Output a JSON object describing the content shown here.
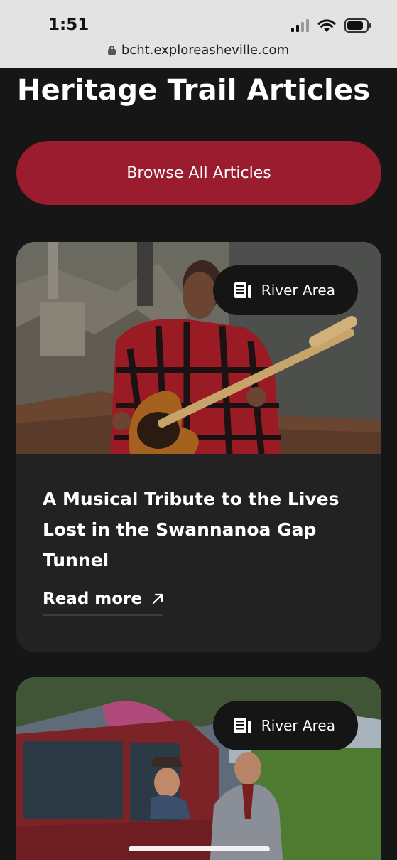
{
  "status_bar": {
    "time": "1:51"
  },
  "browser": {
    "url": "bcht.exploreasheville.com"
  },
  "page": {
    "title": "Heritage Trail Articles"
  },
  "actions": {
    "browse_label": "Browse All Articles"
  },
  "articles": [
    {
      "area": "River Area",
      "title": "A Musical Tribute to the Lives Lost in the Swannanoa Gap Tunnel",
      "read_more": "Read more"
    },
    {
      "area": "River Area"
    }
  ],
  "icons": {
    "lock": "lock-icon",
    "signal": "cellular-signal-icon",
    "wifi": "wifi-icon",
    "battery": "battery-icon",
    "article": "article-icon",
    "arrow": "arrow-up-right-icon"
  },
  "colors": {
    "background": "#161616",
    "card": "#222222",
    "accent": "#9a1c2e",
    "chip": "#151515",
    "status_bar": "#e3e3e3"
  }
}
